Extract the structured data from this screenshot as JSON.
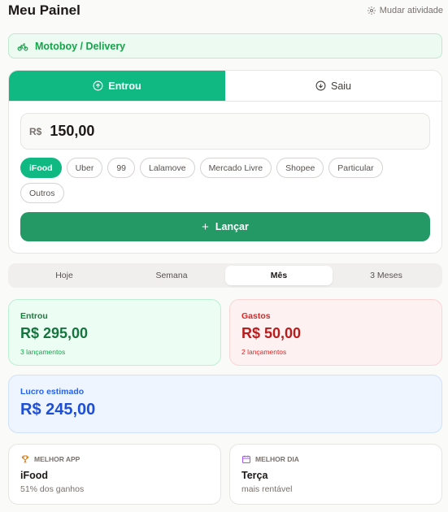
{
  "header": {
    "title": "Meu Painel",
    "change_activity": "Mudar atividade",
    "gear_icon": "gear-icon"
  },
  "activity": {
    "label": "Motoboy / Delivery",
    "icon": "bike-icon",
    "color": "#16a34a"
  },
  "entry": {
    "tabs": [
      {
        "label": "Entrou",
        "icon": "arrow-up-circle-icon",
        "active": true
      },
      {
        "label": "Saiu",
        "icon": "arrow-down-circle-icon",
        "active": false
      }
    ],
    "currency": "R$",
    "amount": "150,00",
    "chips": [
      {
        "label": "iFood",
        "selected": true
      },
      {
        "label": "Uber",
        "selected": false
      },
      {
        "label": "99",
        "selected": false
      },
      {
        "label": "Lalamove",
        "selected": false
      },
      {
        "label": "Mercado Livre",
        "selected": false
      },
      {
        "label": "Shopee",
        "selected": false
      },
      {
        "label": "Particular",
        "selected": false
      },
      {
        "label": "Outros",
        "selected": false
      }
    ],
    "launch_label": "Lançar",
    "accent": "#10b981",
    "button_color": "#249865"
  },
  "periods": [
    {
      "label": "Hoje",
      "active": false
    },
    {
      "label": "Semana",
      "active": false
    },
    {
      "label": "Mês",
      "active": true
    },
    {
      "label": "3 Meses",
      "active": false
    }
  ],
  "stats": {
    "in": {
      "label": "Entrou",
      "value": "R$ 295,00",
      "sub": "3 lançamentos"
    },
    "out": {
      "label": "Gastos",
      "value": "R$ 50,00",
      "sub": "2 lançamentos"
    },
    "profit": {
      "label": "Lucro estimado",
      "value": "R$ 245,00"
    }
  },
  "best": {
    "app": {
      "head": "MELHOR APP",
      "icon": "trophy-icon",
      "main": "iFood",
      "sub": "51% dos ganhos"
    },
    "day": {
      "head": "MELHOR DIA",
      "icon": "calendar-icon",
      "main": "Terça",
      "sub": "mais rentável"
    }
  }
}
